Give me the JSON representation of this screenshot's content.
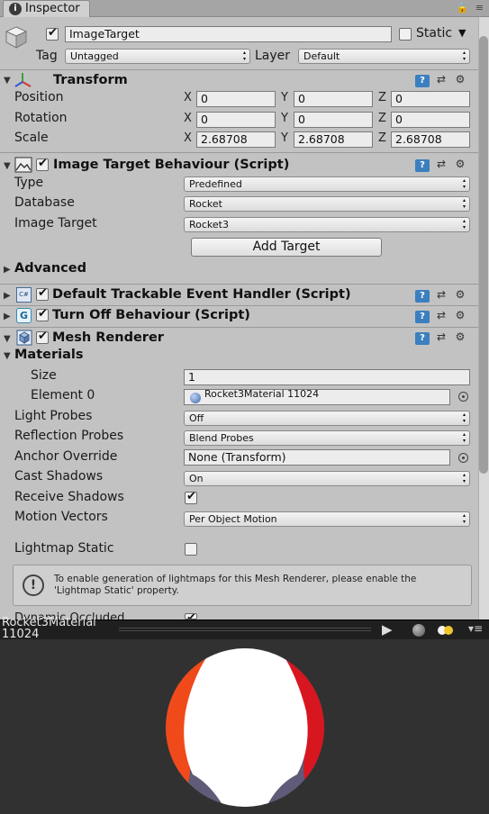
{
  "tab": {
    "label": "Inspector",
    "icon": "info-icon"
  },
  "object": {
    "name": "ImageTarget",
    "active": true,
    "static_label": "Static",
    "static_checked": false,
    "tag_label": "Tag",
    "tag_value": "Untagged",
    "layer_label": "Layer",
    "layer_value": "Default"
  },
  "transform": {
    "title": "Transform",
    "position_label": "Position",
    "rotation_label": "Rotation",
    "scale_label": "Scale",
    "position": {
      "x": "0",
      "y": "0",
      "z": "0"
    },
    "rotation": {
      "x": "0",
      "y": "0",
      "z": "0"
    },
    "scale": {
      "x": "2.68708",
      "y": "2.68708",
      "z": "2.68708"
    },
    "axis_x": "X",
    "axis_y": "Y",
    "axis_z": "Z"
  },
  "image_target": {
    "title": "Image Target Behaviour (Script)",
    "enabled": true,
    "type_label": "Type",
    "type_value": "Predefined",
    "database_label": "Database",
    "database_value": "Rocket",
    "image_target_label": "Image Target",
    "image_target_value": "Rocket3",
    "add_target_label": "Add Target",
    "advanced_label": "Advanced"
  },
  "components": {
    "trackable": {
      "title": "Default Trackable Event Handler (Script)",
      "enabled": true
    },
    "turnoff": {
      "title": "Turn Off Behaviour (Script)",
      "enabled": true
    }
  },
  "mesh_renderer": {
    "title": "Mesh Renderer",
    "enabled": true,
    "materials_label": "Materials",
    "size_label": "Size",
    "size_value": "1",
    "element0_label": "Element 0",
    "element0_value": "Rocket3Material 11024",
    "light_probes_label": "Light Probes",
    "light_probes_value": "Off",
    "reflection_probes_label": "Reflection Probes",
    "reflection_probes_value": "Blend Probes",
    "anchor_override_label": "Anchor Override",
    "anchor_override_value": "None (Transform)",
    "cast_shadows_label": "Cast Shadows",
    "cast_shadows_value": "On",
    "receive_shadows_label": "Receive Shadows",
    "receive_shadows_checked": true,
    "motion_vectors_label": "Motion Vectors",
    "motion_vectors_value": "Per Object Motion",
    "lightmap_static_label": "Lightmap Static",
    "lightmap_static_checked": false,
    "help_text": "To enable generation of lightmaps for this Mesh Renderer, please enable the 'Lightmap Static' property.",
    "dynamic_occluded_label": "Dynamic Occluded"
  },
  "preview": {
    "title": "Rocket3Material 11024",
    "play_icon": "play-icon",
    "sphere_icon": "sphere-icon",
    "lights_icon": "lights-icon",
    "menu_icon": "menu-icon"
  },
  "colors": {
    "help_blue": "#3b7fbf",
    "sphere_red": "#d8161f",
    "sphere_orange": "#f04a1a",
    "sphere_gray": "#5f5b78"
  }
}
